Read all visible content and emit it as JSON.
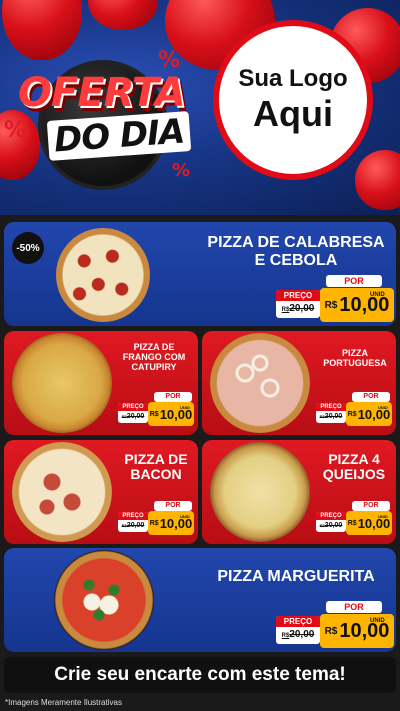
{
  "header": {
    "promo_line1": "OFERTA",
    "promo_line2": "DO DIA",
    "percent_symbol": "%",
    "logo_line1": "Sua Logo",
    "logo_line2": "Aqui"
  },
  "products": [
    {
      "discount": "-50%",
      "name_line1": "PIZZA DE CALABRESA",
      "name_line2": "E CEBOLA",
      "por_label": "POR",
      "preco_label": "PREÇO",
      "old_price_prefix": "R$",
      "old_price": "20,00",
      "currency": "R$",
      "price": "10,00",
      "unit": "UNID"
    },
    {
      "name_line1": "PIZZA DE",
      "name_line2": "FRANGO COM",
      "name_line3": "CATUPIRY",
      "por_label": "POR",
      "preco_label": "PREÇO",
      "old_price_prefix": "R$",
      "old_price": "20,00",
      "currency": "R$",
      "price": "10,00",
      "unit": "UNID"
    },
    {
      "name_line1": "PIZZA",
      "name_line2": "PORTUGUESA",
      "por_label": "POR",
      "preco_label": "PREÇO",
      "old_price_prefix": "R$",
      "old_price": "20,00",
      "currency": "R$",
      "price": "10,00",
      "unit": "UNID"
    },
    {
      "name_line1": "PIZZA DE",
      "name_line2": "BACON",
      "por_label": "POR",
      "preco_label": "PREÇO",
      "old_price_prefix": "R$",
      "old_price": "20,00",
      "currency": "R$",
      "price": "10,00",
      "unit": "UNID"
    },
    {
      "name_line1": "PIZZA 4",
      "name_line2": "QUEIJOS",
      "por_label": "POR",
      "preco_label": "PREÇO",
      "old_price_prefix": "R$",
      "old_price": "20,00",
      "currency": "R$",
      "price": "10,00",
      "unit": "UNID"
    },
    {
      "name_line1": "PIZZA MARGUERITA",
      "por_label": "POR",
      "preco_label": "PREÇO",
      "old_price_prefix": "R$",
      "old_price": "20,00",
      "currency": "R$",
      "price": "10,00",
      "unit": "UNID"
    }
  ],
  "footer": {
    "cta": "Crie seu encarte com este tema!",
    "note": "*Imagens Meramente Ilustrativas"
  },
  "colors": {
    "blue_panel": "#1d3f9e",
    "red_panel": "#d1131b",
    "price_yellow": "#ffb400",
    "accent_red": "#e00b16"
  }
}
